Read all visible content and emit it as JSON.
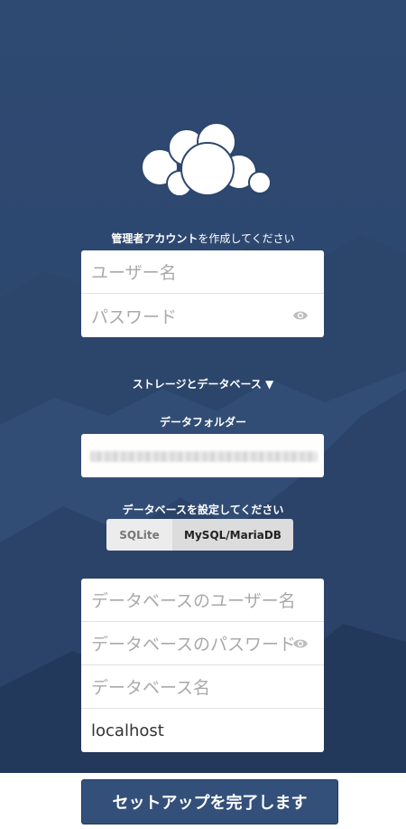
{
  "colors": {
    "background": "#2c476e",
    "button": "#33507a",
    "text_on_dark": "#ffffff",
    "placeholder": "#a9a9a9"
  },
  "logo": {
    "icon": "cloud-logo-icon"
  },
  "admin": {
    "heading_bold": "管理者アカウント",
    "heading_rest": "を作成してください",
    "username_placeholder": "ユーザー名",
    "password_placeholder": "パスワード",
    "show_password_icon": "eye-icon"
  },
  "storage": {
    "toggle_label": "ストレージとデータベース ▼",
    "data_folder_label": "データフォルダー"
  },
  "database": {
    "heading": "データベースを設定してください",
    "tabs": [
      {
        "label": "SQLite",
        "selected": false
      },
      {
        "label": "MySQL/MariaDB",
        "selected": true
      }
    ],
    "db_user_placeholder": "データベースのユーザー名",
    "db_password_placeholder": "データベースのパスワード",
    "db_name_placeholder": "データベース名",
    "db_host_value": "localhost"
  },
  "finish_button": "セットアップを完了します"
}
